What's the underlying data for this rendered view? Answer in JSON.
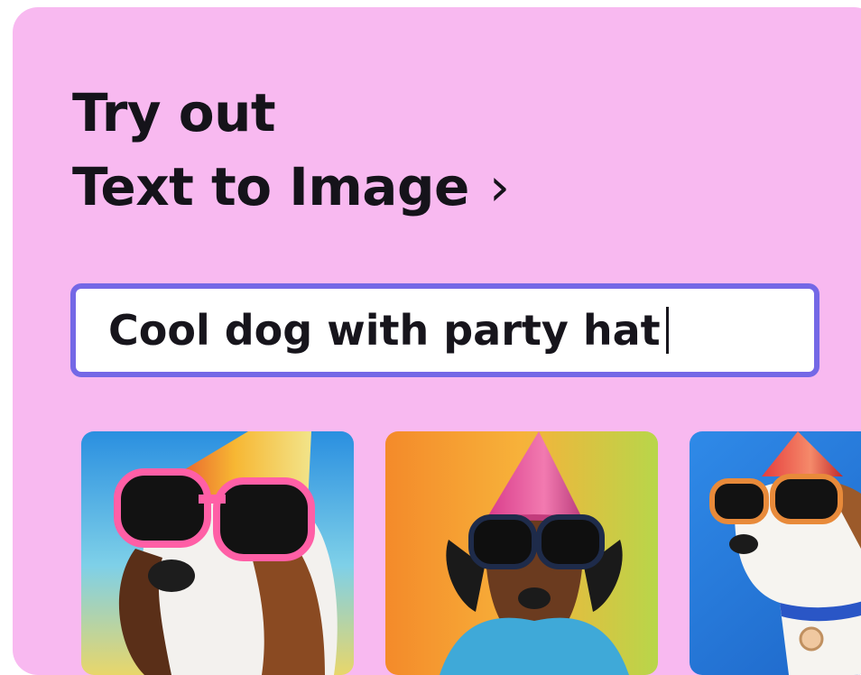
{
  "card": {
    "title_line1": "Try out",
    "title_line2": "Text to Image",
    "chevron": "›"
  },
  "prompt": {
    "value": "Cool dog with party hat"
  },
  "results": [
    {
      "icon": "party-dog-image-1"
    },
    {
      "icon": "party-dog-image-2"
    },
    {
      "icon": "party-dog-image-3"
    }
  ],
  "colors": {
    "card_background": "#f8b9f0",
    "input_border": "#7468e6",
    "text": "#15131a"
  }
}
